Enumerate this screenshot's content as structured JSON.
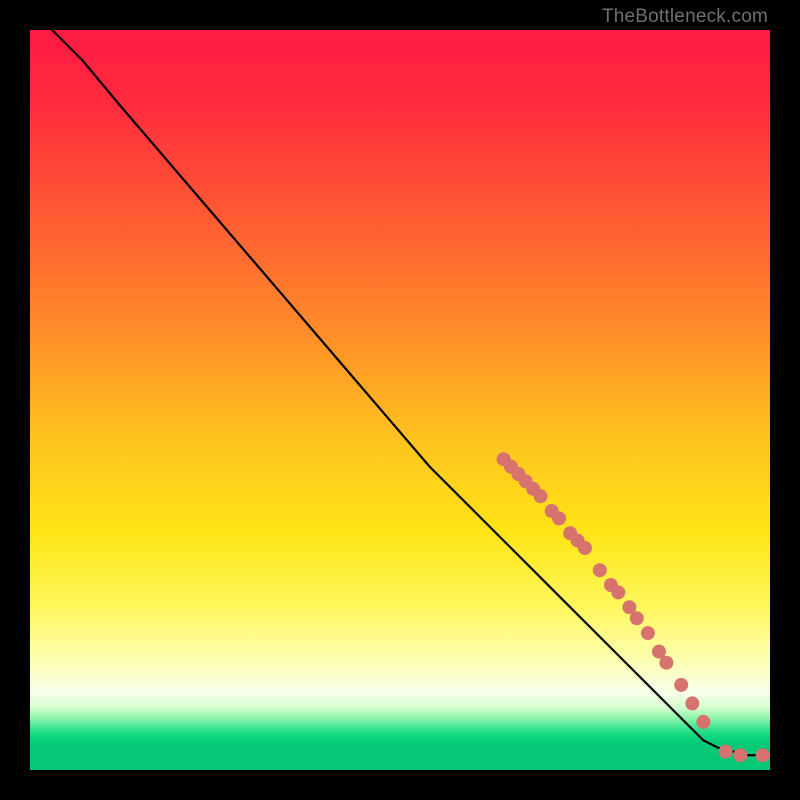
{
  "watermark": "TheBottleneck.com",
  "chart_data": {
    "type": "line",
    "title": "",
    "xlabel": "",
    "ylabel": "",
    "xlim": [
      0,
      100
    ],
    "ylim": [
      0,
      100
    ],
    "grid": false,
    "legend": false,
    "gradient_stops": [
      {
        "offset": 0.0,
        "color": "#ff1a44"
      },
      {
        "offset": 0.1,
        "color": "#ff2b3d"
      },
      {
        "offset": 0.25,
        "color": "#ff5a33"
      },
      {
        "offset": 0.4,
        "color": "#ff8a2a"
      },
      {
        "offset": 0.55,
        "color": "#ffc21f"
      },
      {
        "offset": 0.68,
        "color": "#ffe516"
      },
      {
        "offset": 0.78,
        "color": "#fff75e"
      },
      {
        "offset": 0.85,
        "color": "#fdffb0"
      },
      {
        "offset": 0.895,
        "color": "#f8ffea"
      },
      {
        "offset": 0.915,
        "color": "#d6ffd0"
      },
      {
        "offset": 0.93,
        "color": "#8cf5ac"
      },
      {
        "offset": 0.945,
        "color": "#35e18f"
      },
      {
        "offset": 0.955,
        "color": "#0cd67f"
      },
      {
        "offset": 0.965,
        "color": "#06c877"
      },
      {
        "offset": 1.0,
        "color": "#06c877"
      }
    ],
    "series": [
      {
        "name": "bottleneck-curve",
        "x": [
          3,
          7,
          12,
          18,
          24,
          30,
          36,
          42,
          48,
          54,
          60,
          64,
          68,
          72,
          76,
          80,
          83,
          86,
          89,
          91,
          93,
          95,
          97,
          99
        ],
        "y": [
          100,
          96,
          90,
          83,
          76,
          69,
          62,
          55,
          48,
          41,
          35,
          31,
          27,
          23,
          19,
          15,
          12,
          9,
          6,
          4,
          3,
          2.5,
          2,
          2
        ]
      }
    ],
    "markers": {
      "name": "highlight-dots",
      "color": "#d6736f",
      "radius": 7,
      "points": [
        {
          "x": 64,
          "y": 42
        },
        {
          "x": 65,
          "y": 41
        },
        {
          "x": 66,
          "y": 40
        },
        {
          "x": 67,
          "y": 39
        },
        {
          "x": 68,
          "y": 38
        },
        {
          "x": 69,
          "y": 37
        },
        {
          "x": 70.5,
          "y": 35
        },
        {
          "x": 71.5,
          "y": 34
        },
        {
          "x": 73,
          "y": 32
        },
        {
          "x": 74,
          "y": 31
        },
        {
          "x": 75,
          "y": 30
        },
        {
          "x": 77,
          "y": 27
        },
        {
          "x": 78.5,
          "y": 25
        },
        {
          "x": 79.5,
          "y": 24
        },
        {
          "x": 81,
          "y": 22
        },
        {
          "x": 82,
          "y": 20.5
        },
        {
          "x": 83.5,
          "y": 18.5
        },
        {
          "x": 85,
          "y": 16
        },
        {
          "x": 86,
          "y": 14.5
        },
        {
          "x": 88,
          "y": 11.5
        },
        {
          "x": 89.5,
          "y": 9
        },
        {
          "x": 91,
          "y": 6.5
        },
        {
          "x": 94,
          "y": 2.5
        },
        {
          "x": 96,
          "y": 2
        },
        {
          "x": 99,
          "y": 2
        }
      ]
    }
  }
}
